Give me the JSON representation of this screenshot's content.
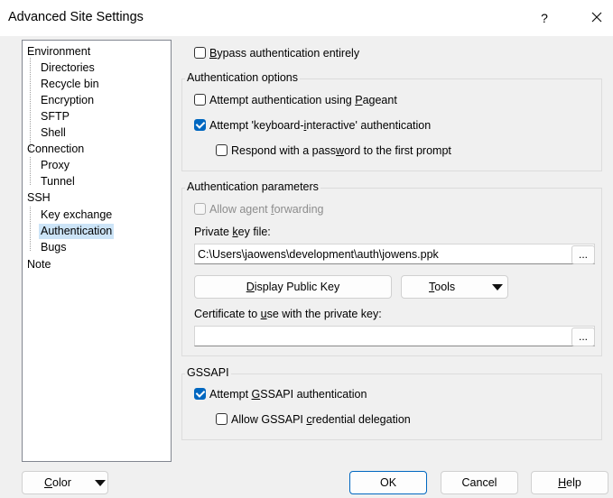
{
  "window": {
    "title": "Advanced Site Settings",
    "help": "?",
    "close": "✕"
  },
  "tree": {
    "items": [
      {
        "label": "Environment"
      },
      {
        "label": "Directories"
      },
      {
        "label": "Recycle bin"
      },
      {
        "label": "Encryption"
      },
      {
        "label": "SFTP"
      },
      {
        "label": "Shell"
      },
      {
        "label": "Connection"
      },
      {
        "label": "Proxy"
      },
      {
        "label": "Tunnel"
      },
      {
        "label": "SSH"
      },
      {
        "label": "Key exchange"
      },
      {
        "label": "Authentication"
      },
      {
        "label": "Bugs"
      },
      {
        "label": "Note"
      }
    ]
  },
  "bypass": {
    "pre": "",
    "u": "B",
    "post": "ypass authentication entirely",
    "checked": false
  },
  "auth_options": {
    "label": "Authentication options",
    "pageant": {
      "pre": "Attempt authentication using ",
      "u": "P",
      "post": "ageant",
      "checked": false
    },
    "kbd": {
      "pre": "Attempt 'keyboard-",
      "u": "i",
      "post": "nteractive' authentication",
      "checked": true
    },
    "respond": {
      "pre": "Respond with a pass",
      "u": "w",
      "post": "ord to the first prompt",
      "checked": false
    }
  },
  "auth_params": {
    "label": "Authentication parameters",
    "agent_fwd": {
      "pre": "Allow agent ",
      "u": "f",
      "post": "orwarding",
      "checked": false
    },
    "private_key_label": {
      "pre": "Private ",
      "u": "k",
      "post": "ey file:"
    },
    "private_key_value": "C:\\Users\\jaowens\\development\\auth\\jowens.ppk",
    "browse": "...",
    "display_key": {
      "pre": "",
      "u": "D",
      "post": "isplay Public Key"
    },
    "tools": {
      "pre": "",
      "u": "T",
      "post": "ools"
    },
    "cert_label": {
      "pre": "Certificate to ",
      "u": "u",
      "post": "se with the private key:"
    },
    "cert_value": "",
    "cert_browse": "..."
  },
  "gssapi": {
    "label": "GSSAPI",
    "attempt": {
      "pre": "Attempt ",
      "u": "G",
      "post": "SSAPI authentication",
      "checked": true
    },
    "delegation": {
      "pre": "Allow GSSAPI ",
      "u": "c",
      "post": "redential delegation",
      "checked": false
    }
  },
  "footer": {
    "color": {
      "pre": "",
      "u": "C",
      "post": "olor"
    },
    "ok": "OK",
    "cancel": "Cancel",
    "help": {
      "pre": "",
      "u": "H",
      "post": "elp"
    }
  }
}
